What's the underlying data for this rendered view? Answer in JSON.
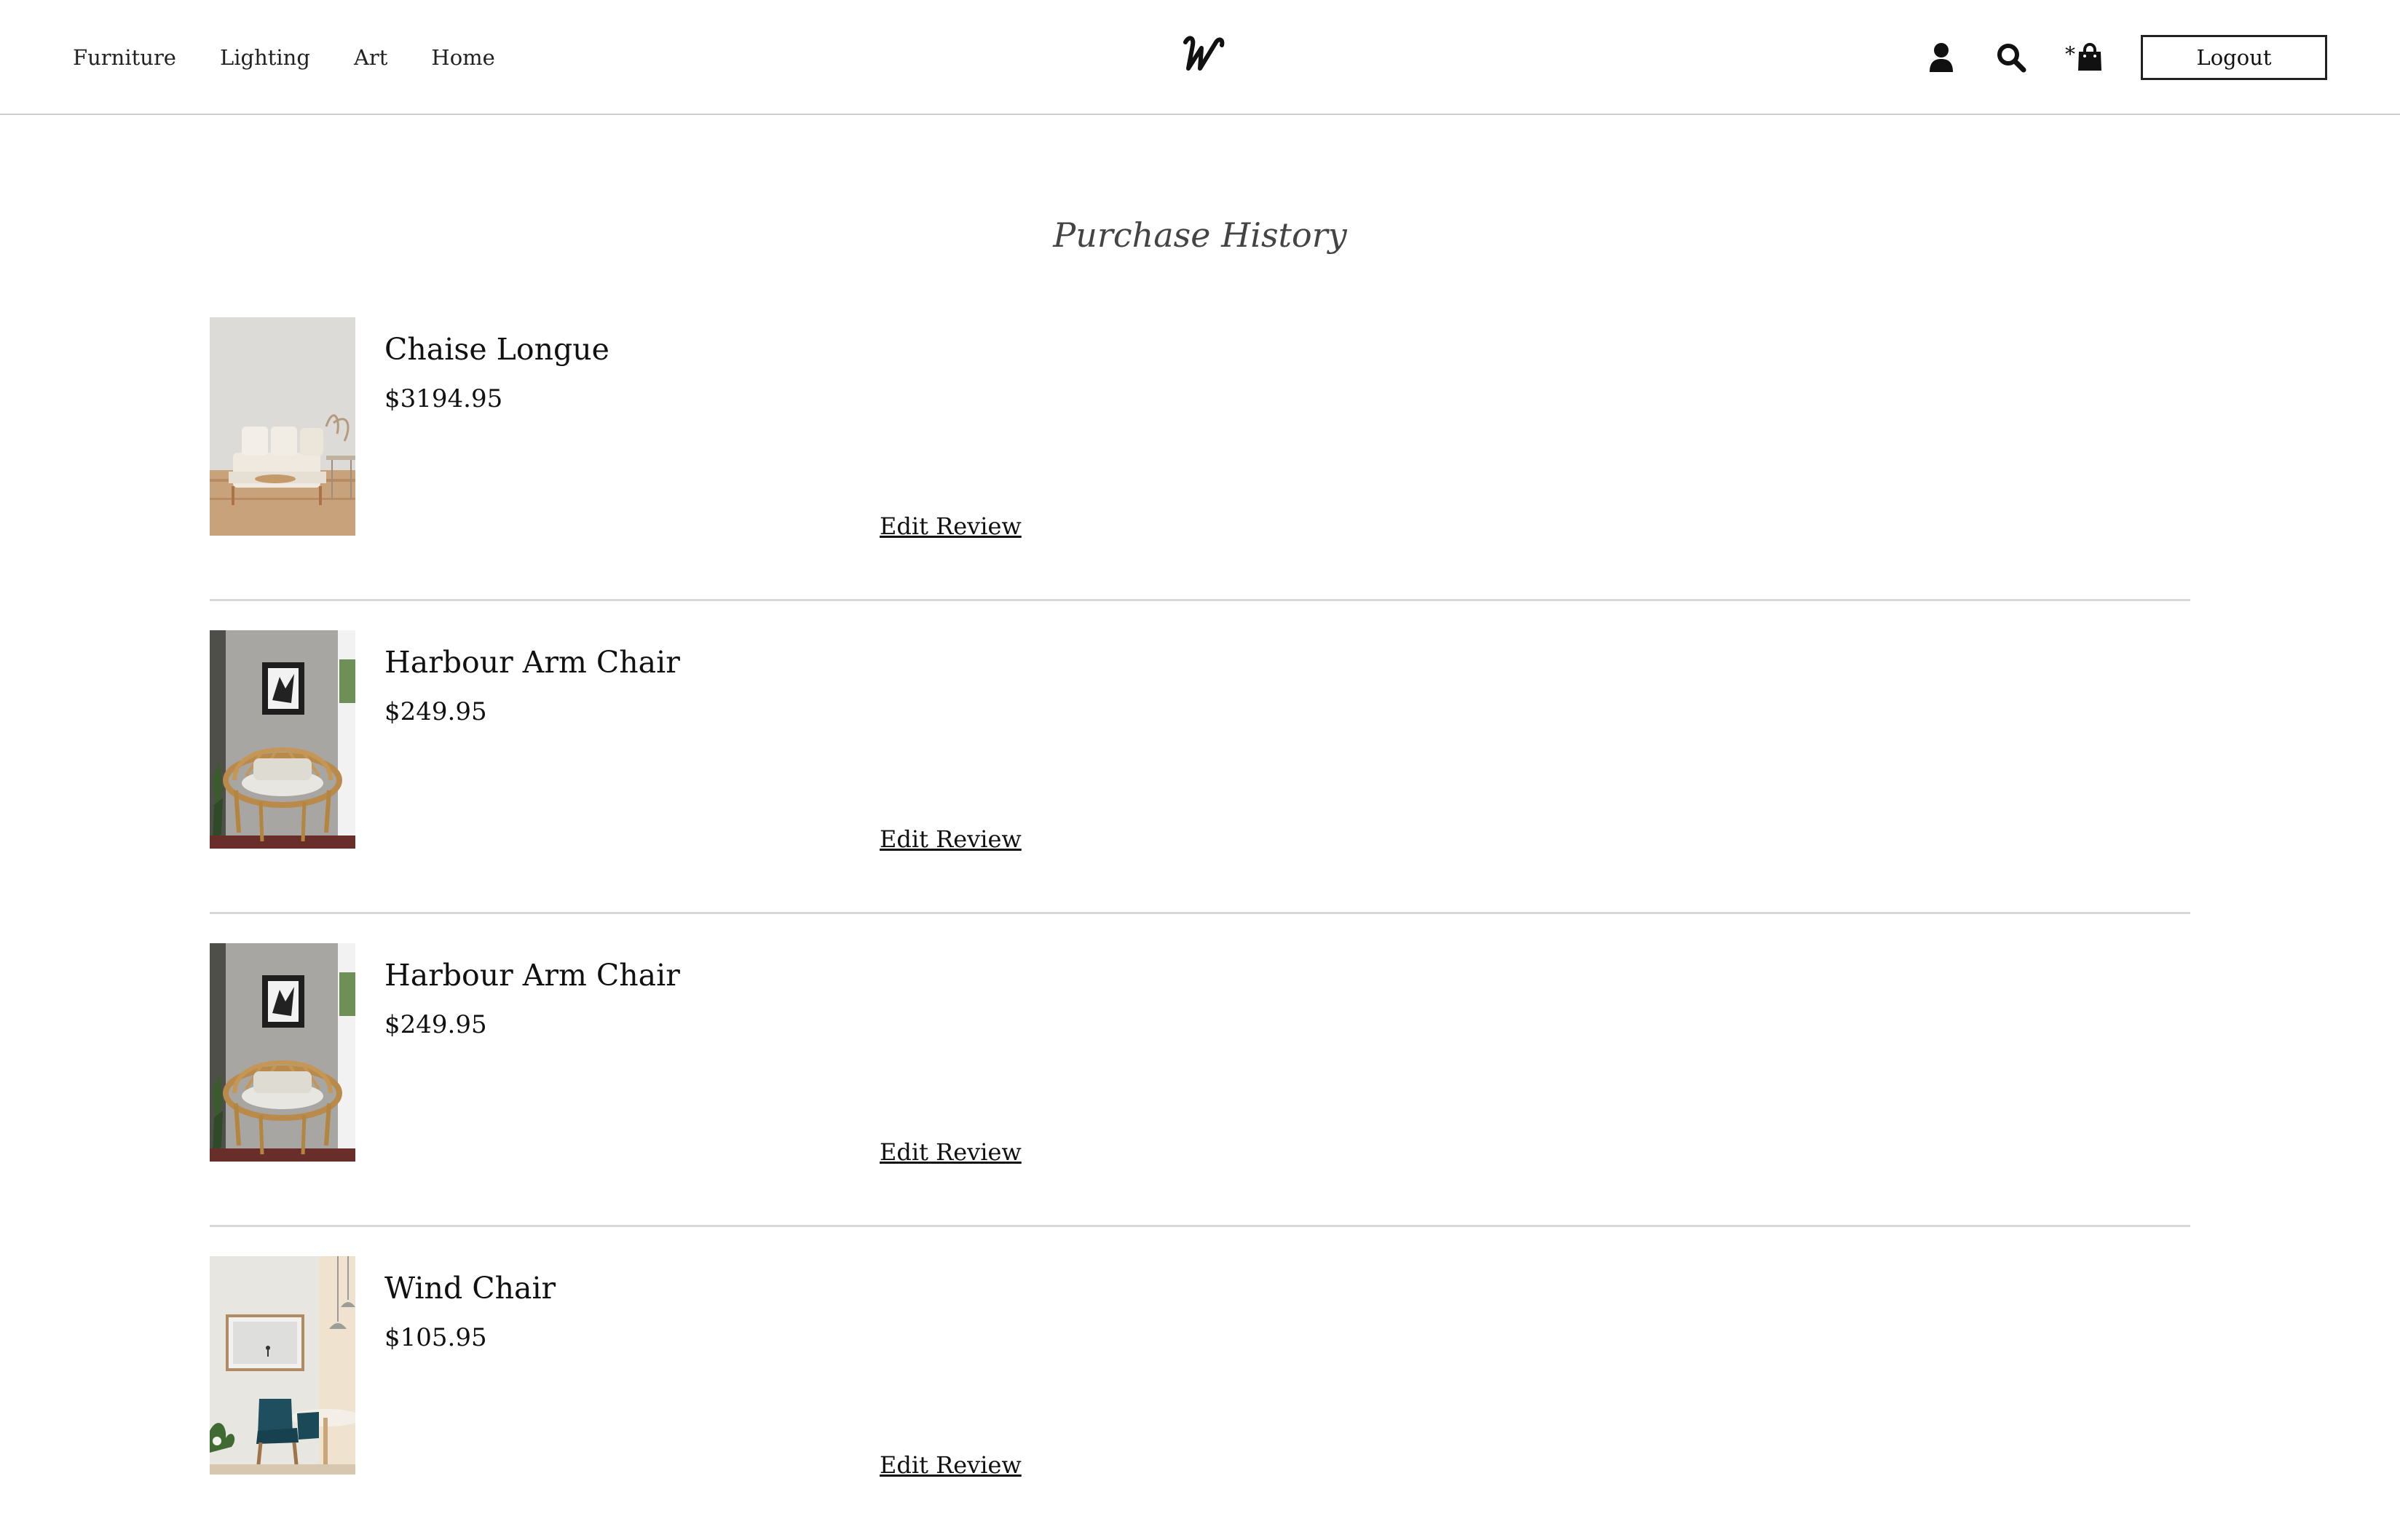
{
  "nav": {
    "items": [
      {
        "label": "Furniture"
      },
      {
        "label": "Lighting"
      },
      {
        "label": "Art"
      },
      {
        "label": "Home"
      }
    ]
  },
  "header": {
    "logo_icon": "script-w-logo",
    "user_icon": "user-icon",
    "search_icon": "search-icon",
    "cart_icon": "shopping-bag-icon",
    "cart_count": "*",
    "logout_label": "Logout"
  },
  "page": {
    "title": "Purchase History"
  },
  "purchases": [
    {
      "name": "Chaise Longue",
      "price": "$3194.95",
      "action": "Edit Review",
      "image": "sofa-photo"
    },
    {
      "name": "Harbour Arm Chair",
      "price": "$249.95",
      "action": "Edit Review",
      "image": "rattan-chair-photo"
    },
    {
      "name": "Harbour Arm Chair",
      "price": "$249.95",
      "action": "Edit Review",
      "image": "rattan-chair-photo"
    },
    {
      "name": "Wind Chair",
      "price": "$105.95",
      "action": "Edit Review",
      "image": "dining-room-photo"
    }
  ],
  "colors": {
    "text": "#111111",
    "title": "#444444",
    "divider": "#d8d8d8",
    "header_border": "#cfcfcf"
  }
}
